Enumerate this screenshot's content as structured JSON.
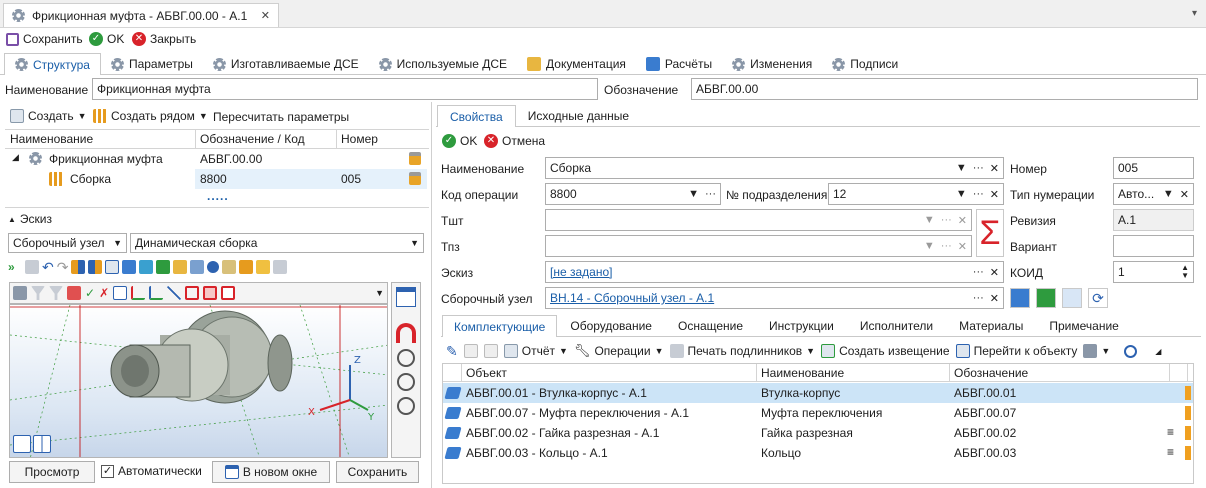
{
  "window": {
    "tab_title": "Фрикционная муфта - АБВГ.00.00 - А.1",
    "close": "✕"
  },
  "toolbar": {
    "save": "Сохранить",
    "ok": "OK",
    "close": "Закрыть"
  },
  "main_tabs": [
    "Структура",
    "Параметры",
    "Изготавливаемые ДСЕ",
    "Используемые ДСЕ",
    "Документация",
    "Расчёты",
    "Изменения",
    "Подписи"
  ],
  "header": {
    "name_label": "Наименование",
    "name_value": "Фрикционная муфта",
    "designation_label": "Обозначение",
    "designation_value": "АБВГ.00.00"
  },
  "left_toolbar": {
    "create": "Создать",
    "create_near": "Создать рядом",
    "recalc": "Пересчитать параметры"
  },
  "tree": {
    "columns": [
      "Наименование",
      "Обозначение / Код",
      "Номер"
    ],
    "rows": [
      {
        "name": "Фрикционная муфта",
        "code": "АБВГ.00.00",
        "number": ""
      },
      {
        "name": "Сборка",
        "code": "8800",
        "number": "005"
      }
    ],
    "more": "....."
  },
  "sketch": {
    "title": "Эскиз",
    "mode": "Сборочный узел",
    "assembly": "Динамическая сборка"
  },
  "bottom": {
    "preview": "Просмотр",
    "auto": "Автоматически",
    "new_window": "В новом окне",
    "save": "Сохранить"
  },
  "right_tabs": [
    "Свойства",
    "Исходные данные"
  ],
  "props_actions": {
    "ok": "OK",
    "cancel": "Отмена"
  },
  "props": {
    "name_label": "Наименование",
    "name_value": "Сборка",
    "opcode_label": "Код операции",
    "opcode_value": "8800",
    "subdiv_label": "№ подразделения",
    "subdiv_value": "12",
    "tsht_label": "Тшт",
    "tpz_label": "Тпз",
    "sketch_label": "Эскиз",
    "sketch_value": "[не задано]",
    "unit_label": "Сборочный узел",
    "unit_value": "ВН.14 - Сборочный узел - А.1",
    "number_label": "Номер",
    "number_value": "005",
    "numtype_label": "Тип нумерации",
    "numtype_value": "Авто...",
    "revision_label": "Ревизия",
    "revision_value": "А.1",
    "variant_label": "Вариант",
    "variant_value": "",
    "koid_label": "КОИД",
    "koid_value": "1",
    "sigma": "Σ"
  },
  "sub_tabs": [
    "Комплектующие",
    "Оборудование",
    "Оснащение",
    "Инструкции",
    "Исполнители",
    "Материалы",
    "Примечание"
  ],
  "comp_toolbar": {
    "report": "Отчёт",
    "operations": "Операции",
    "print": "Печать подлинников",
    "create_notice": "Создать извещение",
    "goto": "Перейти к объекту"
  },
  "comp_table": {
    "columns": [
      "Объект",
      "Наименование",
      "Обозначение"
    ],
    "rows": [
      {
        "object": "АБВГ.00.01 - Втулка-корпус - А.1",
        "name": "Втулка-корпус",
        "code": "АБВГ.00.01"
      },
      {
        "object": "АБВГ.00.07 - Муфта переключения - А.1",
        "name": "Муфта переключения",
        "code": "АБВГ.00.07"
      },
      {
        "object": "АБВГ.00.02 - Гайка разрезная - А.1",
        "name": "Гайка разрезная",
        "code": "АБВГ.00.02"
      },
      {
        "object": "АБВГ.00.03 - Кольцо - А.1",
        "name": "Кольцо",
        "code": "АБВГ.00.03"
      }
    ]
  },
  "colors": {
    "accent": "#1a5ea8",
    "selection": "#cce4f7",
    "orange": "#f0a020",
    "red": "#d8232a",
    "green": "#2e9b3e"
  }
}
